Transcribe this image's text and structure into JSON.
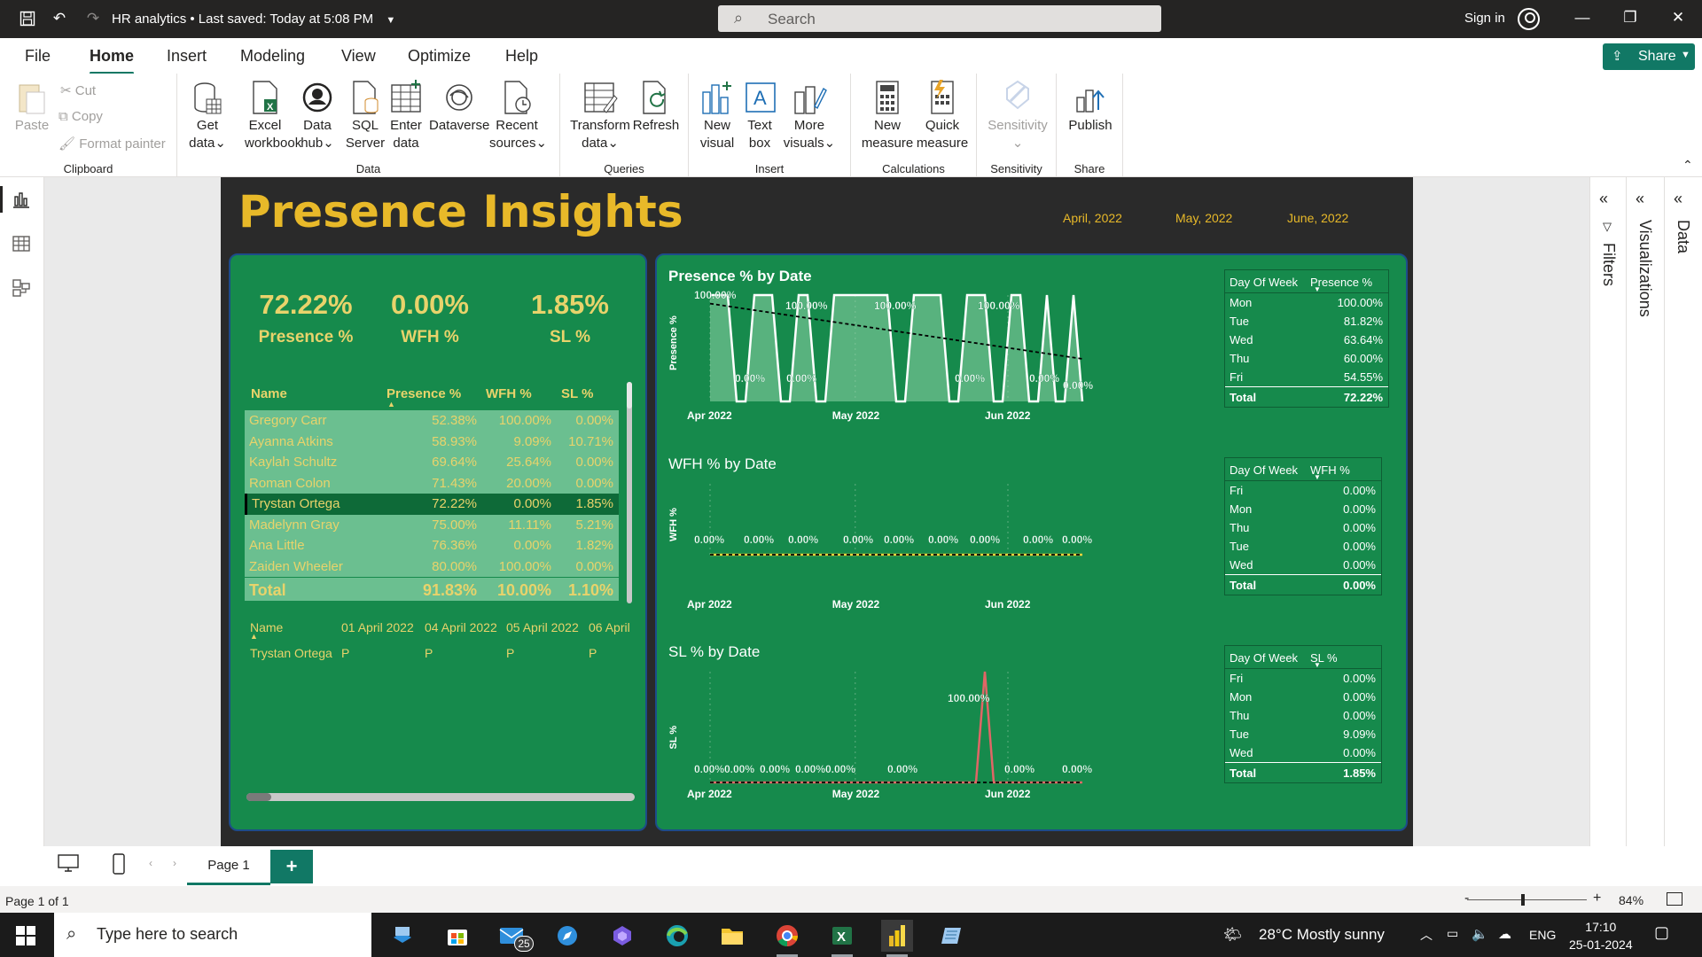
{
  "titlebar": {
    "title": "HR analytics",
    "saved": "Last saved: Today at 5:08 PM",
    "search_placeholder": "Search",
    "signin": "Sign in"
  },
  "menu": {
    "tabs": [
      "File",
      "Home",
      "Insert",
      "Modeling",
      "View",
      "Optimize",
      "Help"
    ],
    "active": "Home",
    "share": "Share"
  },
  "ribbon": {
    "clipboard": {
      "paste": "Paste",
      "cut": "Cut",
      "copy": "Copy",
      "format_painter": "Format painter",
      "label": "Clipboard"
    },
    "data": {
      "get_data": [
        "Get",
        "data"
      ],
      "excel": [
        "Excel",
        "workbook"
      ],
      "data_hub": [
        "Data",
        "hub"
      ],
      "sql": [
        "SQL",
        "Server"
      ],
      "enter": [
        "Enter",
        "data"
      ],
      "dataverse": "Dataverse",
      "recent": [
        "Recent",
        "sources"
      ],
      "label": "Data"
    },
    "queries": {
      "transform": [
        "Transform",
        "data"
      ],
      "refresh": "Refresh",
      "label": "Queries"
    },
    "insert": {
      "new_visual": [
        "New",
        "visual"
      ],
      "text_box": [
        "Text",
        "box"
      ],
      "more_visuals": [
        "More",
        "visuals"
      ],
      "label": "Insert"
    },
    "calculations": {
      "new_measure": [
        "New",
        "measure"
      ],
      "quick_measure": [
        "Quick",
        "measure"
      ],
      "label": "Calculations"
    },
    "sensitivity": {
      "btn": "Sensitivity",
      "label": "Sensitivity"
    },
    "share": {
      "publish": "Publish",
      "label": "Share"
    }
  },
  "report": {
    "title": "Presence Insights",
    "months": [
      "April, 2022",
      "May, 2022",
      "June, 2022"
    ],
    "kpis": [
      {
        "value": "72.22%",
        "label": "Presence %"
      },
      {
        "value": "0.00%",
        "label": "WFH %"
      },
      {
        "value": "1.85%",
        "label": "SL %"
      }
    ],
    "employee_table": {
      "headers": [
        "Name",
        "Presence %",
        "WFH %",
        "SL %"
      ],
      "rows": [
        [
          "Gregory Carr",
          "52.38%",
          "100.00%",
          "0.00%"
        ],
        [
          "Ayanna Atkins",
          "58.93%",
          "9.09%",
          "10.71%"
        ],
        [
          "Kaylah Schultz",
          "69.64%",
          "25.64%",
          "0.00%"
        ],
        [
          "Roman Colon",
          "71.43%",
          "20.00%",
          "0.00%"
        ],
        [
          "Trystan Ortega",
          "72.22%",
          "0.00%",
          "1.85%"
        ],
        [
          "Madelynn Gray",
          "75.00%",
          "11.11%",
          "5.21%"
        ],
        [
          "Ana Little",
          "76.36%",
          "0.00%",
          "1.82%"
        ],
        [
          "Zaiden Wheeler",
          "80.00%",
          "100.00%",
          "0.00%"
        ]
      ],
      "selected_row": 4,
      "total": [
        "Total",
        "91.83%",
        "10.00%",
        "1.10%"
      ]
    },
    "attendance_matrix": {
      "headers": [
        "Name",
        "01 April 2022",
        "04 April 2022",
        "05 April 2022",
        "06 April"
      ],
      "row": [
        "Trystan Ortega",
        "P",
        "P",
        "P",
        "P"
      ]
    },
    "charts": {
      "presence": {
        "title": "Presence % by Date",
        "ylabel": "Presence %"
      },
      "wfh": {
        "title": "WFH % by Date",
        "ylabel": "WFH %"
      },
      "sl": {
        "title": "SL % by Date",
        "ylabel": "SL %"
      }
    },
    "dow_tables": {
      "presence": {
        "headers": [
          "Day Of Week",
          "Presence %"
        ],
        "rows": [
          [
            "Mon",
            "100.00%"
          ],
          [
            "Tue",
            "81.82%"
          ],
          [
            "Wed",
            "63.64%"
          ],
          [
            "Thu",
            "60.00%"
          ],
          [
            "Fri",
            "54.55%"
          ]
        ],
        "total": [
          "Total",
          "72.22%"
        ]
      },
      "wfh": {
        "headers": [
          "Day Of Week",
          "WFH %"
        ],
        "rows": [
          [
            "Fri",
            "0.00%"
          ],
          [
            "Mon",
            "0.00%"
          ],
          [
            "Thu",
            "0.00%"
          ],
          [
            "Tue",
            "0.00%"
          ],
          [
            "Wed",
            "0.00%"
          ]
        ],
        "total": [
          "Total",
          "0.00%"
        ]
      },
      "sl": {
        "headers": [
          "Day Of Week",
          "SL %"
        ],
        "rows": [
          [
            "Fri",
            "0.00%"
          ],
          [
            "Mon",
            "0.00%"
          ],
          [
            "Thu",
            "0.00%"
          ],
          [
            "Tue",
            "9.09%"
          ],
          [
            "Wed",
            "0.00%"
          ]
        ],
        "total": [
          "Total",
          "1.85%"
        ]
      }
    }
  },
  "chart_data": [
    {
      "type": "area",
      "title": "Presence % by Date",
      "ylabel": "Presence %",
      "x_ticks": [
        "Apr 2022",
        "May 2022",
        "Jun 2022"
      ],
      "ylim": [
        0,
        1
      ],
      "values": [
        1,
        1,
        1,
        0,
        0,
        1,
        1,
        1,
        0,
        0,
        1,
        1,
        0,
        0,
        1,
        1,
        1,
        1,
        1,
        1,
        1,
        0,
        0,
        1,
        1,
        1,
        1,
        0,
        0,
        1,
        1,
        1,
        0,
        0,
        1,
        1,
        0,
        0,
        1,
        0,
        0,
        1,
        0
      ],
      "labels": [
        "100.00%",
        "100.00%",
        "100.00%",
        "100.00%",
        "0.00%",
        "0.00%",
        "0.00%",
        "0.00%",
        "0.00%"
      ],
      "trendline": true
    },
    {
      "type": "line",
      "title": "WFH % by Date",
      "ylabel": "WFH %",
      "x_ticks": [
        "Apr 2022",
        "May 2022",
        "Jun 2022"
      ],
      "values": [
        0,
        0,
        0,
        0,
        0,
        0,
        0,
        0,
        0,
        0,
        0,
        0,
        0,
        0,
        0,
        0,
        0,
        0,
        0,
        0,
        0,
        0,
        0,
        0,
        0,
        0,
        0,
        0,
        0,
        0,
        0,
        0,
        0,
        0,
        0,
        0,
        0,
        0,
        0,
        0,
        0,
        0,
        0
      ],
      "labels": [
        "0.00%",
        "0.00%",
        "0.00%",
        "0.00%",
        "0.00%",
        "0.00%",
        "0.00%",
        "0.00%",
        "0.00%"
      ],
      "trendline": true
    },
    {
      "type": "line",
      "title": "SL % by Date",
      "ylabel": "SL %",
      "x_ticks": [
        "Apr 2022",
        "May 2022",
        "Jun 2022"
      ],
      "values": [
        0,
        0,
        0,
        0,
        0,
        0,
        0,
        0,
        0,
        0,
        0,
        0,
        0,
        0,
        0,
        0,
        0,
        0,
        0,
        0,
        0,
        0,
        0,
        0,
        0,
        0,
        0,
        0,
        0,
        0,
        0,
        1,
        0,
        0,
        0,
        0,
        0,
        0,
        0,
        0,
        0,
        0,
        0
      ],
      "labels": [
        "0.00%",
        "0.00%",
        "0.00%",
        "0.00%",
        "0.00%",
        "0.00%",
        "100.00%",
        "0.00%",
        "0.00%"
      ],
      "trendline": true
    }
  ],
  "colors": {
    "canvas_bg": "#2a2a2a",
    "panel": "#168a4c",
    "accent": "#e8b929",
    "kpi_text": "#e8d36b",
    "area_fill": "#8fd3a8",
    "sl_line": "#e06666",
    "wfh_line": "#f2d23a",
    "brand": "#117865"
  },
  "panes": {
    "filters": "Filters",
    "visualizations": "Visualizations",
    "data": "Data"
  },
  "pages": {
    "current": "Page 1"
  },
  "status": {
    "page_info": "Page 1 of 1",
    "zoom": "84%"
  },
  "taskbar": {
    "search_placeholder": "Type here to search",
    "mail_badge": "25",
    "weather": "28°C  Mostly sunny",
    "lang": "ENG",
    "time": "17:10",
    "date": "25-01-2024"
  }
}
